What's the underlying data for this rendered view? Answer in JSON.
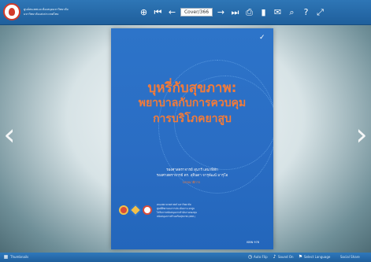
{
  "header": {
    "brand_line1": "ศูนย์สนเทศและห้องสมุดมหาวิทยาลัย",
    "brand_line2": "มหาวิทยาลัยแห่งประเทศไทย",
    "page_indicator": "Cover/366",
    "icons": [
      "zoom-in-icon",
      "first-page-icon",
      "previous-page-icon",
      "next-page-icon",
      "last-page-icon",
      "print-icon",
      "bookmark-icon",
      "email-icon",
      "search-icon",
      "help-icon",
      "fullscreen-icon"
    ]
  },
  "cover": {
    "title_line1": "บุหรี่กับสุขภาพ:",
    "title_line2": "พยาบาลกับการควบคุม",
    "title_line3": "การบริโภคยาสูบ",
    "author1": "รองศาสตราจารย์ สุนารี  เสนาพิทัก",
    "author2": "รองศาสตราจารย์ ดร. สุจินดา  จารุพัฒน์ มารุโอ",
    "edition": "บรรณาธิการ",
    "publisher1": "คณะพยาบาลศาสตร์ มหาวิทยาลัย",
    "publisher2": "ศูนย์ศึกษาและการประเมินภาวะยาสูบ",
    "publisher3": "ได้รับการสนับสนุนจากสำนักงานกองทุน",
    "publisher4": "สนับสนุนการสร้างเสริมสุขภาพ (สสส.)",
    "isbn": "ISBN 978"
  },
  "footer": {
    "left_label": "Thumbnails",
    "auto_flip": "Auto Flip",
    "sound": "Sound On",
    "language": "Select Language",
    "social": "Social Share"
  },
  "colors": {
    "toolbar": "#2870b1",
    "cover_blue": "#2a6dc4",
    "title_orange": "#f27b3a"
  }
}
